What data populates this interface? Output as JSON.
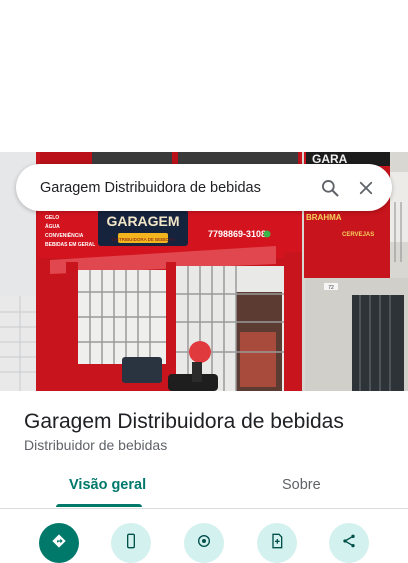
{
  "search": {
    "query": "Garagem Distribuidora de bebidas"
  },
  "place": {
    "name": "Garagem Distribuidora de bebidas",
    "category": "Distribuidor de bebidas"
  },
  "photo": {
    "sign_name": "GARAGEM",
    "sign_subtitle": "DISTRIBUIDORA DE BEBIDAS",
    "sign_phone": "7798869-3108",
    "sign_list": [
      "GELO",
      "ÁGUA",
      "CONVENIÊNCIA",
      "BEBIDAS EM GERAL"
    ],
    "house_number": "72",
    "right_sign_top": "GARA",
    "right_sign_side": "BRAHMA",
    "right_sign_small": "CERVEJAS"
  },
  "tabs": [
    {
      "label": "Visão geral",
      "active": true
    },
    {
      "label": "Sobre",
      "active": false
    }
  ],
  "actions": [
    {
      "icon": "directions-icon"
    },
    {
      "icon": "phone-icon"
    },
    {
      "icon": "location-icon"
    },
    {
      "icon": "save-icon"
    },
    {
      "icon": "share-icon"
    }
  ],
  "colors": {
    "accent": "#00796b",
    "action_bg": "#d3f1ee",
    "facade_red": "#d3141f"
  }
}
